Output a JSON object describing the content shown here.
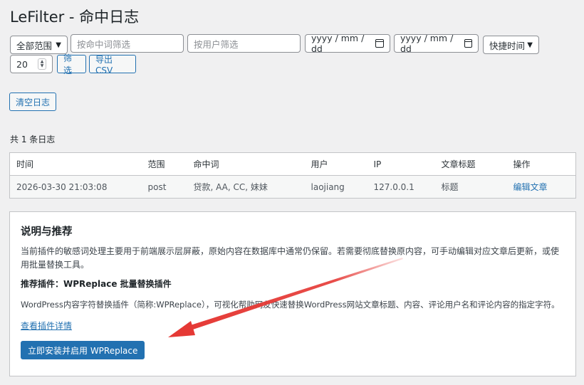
{
  "page": {
    "title": "LeFilter - 命中日志"
  },
  "filters": {
    "scope_value": "全部范围",
    "keyword_placeholder": "按命中词筛选",
    "user_placeholder": "按用户筛选",
    "date_from_placeholder": "yyyy / mm / dd",
    "date_to_placeholder": "yyyy / mm / dd",
    "quick_time_value": "快捷时间",
    "per_page_value": "20",
    "filter_button": "筛选",
    "export_button": "导出 CSV"
  },
  "actions": {
    "clear_logs_button": "清空日志"
  },
  "summary": {
    "count_text": "共 1 条日志"
  },
  "table": {
    "headers": [
      "时间",
      "范围",
      "命中词",
      "用户",
      "IP",
      "文章标题",
      "操作"
    ],
    "rows": [
      {
        "time": "2026-03-30 21:03:08",
        "scope": "post",
        "words": "贷款, AA, CC, 妹妹",
        "user": "laojiang",
        "ip": "127.0.0.1",
        "post_title": "标题",
        "action": "编辑文章"
      }
    ]
  },
  "info_panel": {
    "heading": "说明与推荐",
    "description": "当前插件的敏感词处理主要用于前端展示层屏蔽，原始内容在数据库中通常仍保留。若需要彻底替换原内容，可手动编辑对应文章后更新，或使用批量替换工具。",
    "recommend_label": "推荐插件：WPReplace 批量替换插件",
    "plugin_description": "WordPress内容字符替换插件（简称:WPReplace），可视化帮助网友快速替换WordPress网站文章标题、内容、评论用户名和评论内容的指定字符。",
    "details_link": "查看插件详情",
    "install_button": "立即安装并启用 WPReplace"
  },
  "icons": {
    "select": "chevron-down-icon",
    "date": "calendar-icon",
    "number": "spinner-icon"
  },
  "colors": {
    "accent": "#2271b1",
    "annotation_arrow": "#e53935",
    "background": "#f0f0f1"
  }
}
